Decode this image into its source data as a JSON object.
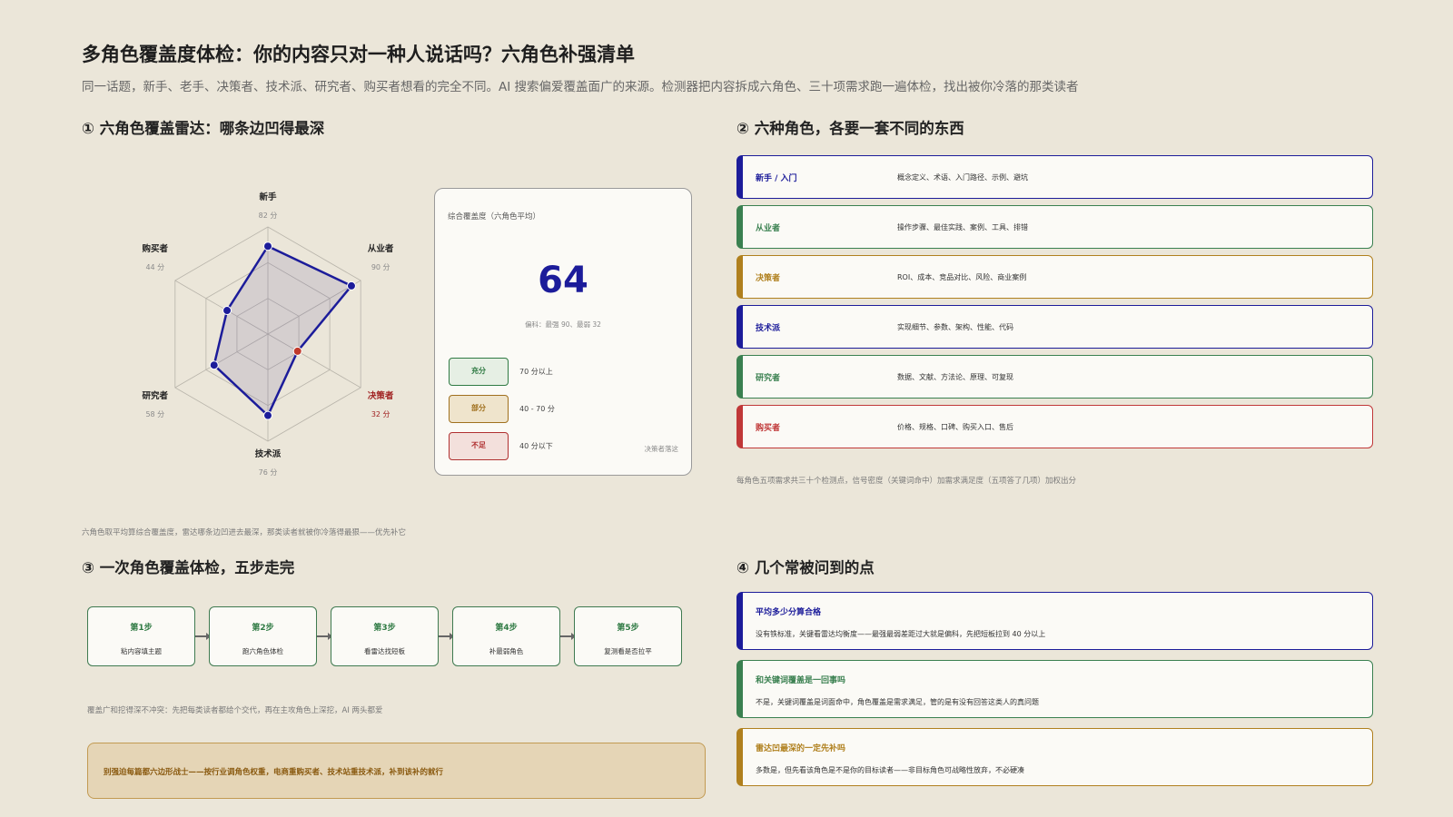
{
  "header": {
    "title": "多角色覆盖度体检：你的内容只对一种人说话吗？六角色补强清单",
    "subtitle": "同一话题，新手、老手、决策者、技术派、研究者、购买者想看的完全不同。AI 搜索偏爱覆盖面广的来源。检测器把内容拆成六角色、三十项需求跑一遍体检，找出被你冷落的那类读者"
  },
  "section1": {
    "title": "① 六角色覆盖雷达：哪条边凹得最深",
    "caption": "六角色取平均算综合覆盖度，雷达哪条边凹进去最深，那类读者就被你冷落得最狠——优先补它"
  },
  "radar": {
    "roles": [
      {
        "name": "新手",
        "score": 82,
        "score_label": "82 分",
        "status": "ok"
      },
      {
        "name": "从业者",
        "score": 90,
        "score_label": "90 分",
        "status": "ok"
      },
      {
        "name": "决策者",
        "score": 32,
        "score_label": "32 分",
        "status": "weak"
      },
      {
        "name": "技术派",
        "score": 76,
        "score_label": "76 分",
        "status": "ok"
      },
      {
        "name": "研究者",
        "score": 58,
        "score_label": "58 分",
        "status": "ok"
      },
      {
        "name": "购买者",
        "score": 44,
        "score_label": "44 分",
        "status": "ok"
      }
    ],
    "max": 100,
    "rings": 3,
    "colors": {
      "line": "#1c1c9a",
      "fill": "rgba(60,40,140,0.12)",
      "weak_point": "#c0392b",
      "weak_label": "#a02020",
      "grid": "#b8b4aa"
    }
  },
  "score_card": {
    "label": "综合覆盖度（六角色平均）",
    "value": "64",
    "bias": "偏科：最强 90、最弱 32",
    "legend": [
      {
        "badge": "充分",
        "text": "70 分以上",
        "color": "#2f7a43",
        "bg": "#e6efe4"
      },
      {
        "badge": "部分",
        "text": "40 - 70 分",
        "color": "#a0701e",
        "bg": "#efe4cc"
      },
      {
        "badge": "不足",
        "text": "40 分以下",
        "color": "#b03030",
        "bg": "#f3e0dc"
      }
    ],
    "note": "决策者落这"
  },
  "section2": {
    "title": "② 六种角色，各要一套不同的东西",
    "caption": "每角色五项需求共三十个检测点，信号密度（关键词命中）加需求满足度（五项答了几项）加权出分"
  },
  "roles": [
    {
      "name": "新手 / 入门",
      "needs": "概念定义、术语、入门路径、示例、避坑",
      "color": "#1c1c9a"
    },
    {
      "name": "从业者",
      "needs": "操作步骤、最佳实践、案例、工具、排错",
      "color": "#3a8050"
    },
    {
      "name": "决策者",
      "needs": "ROI、成本、竞品对比、风险、商业案例",
      "color": "#b0801e"
    },
    {
      "name": "技术派",
      "needs": "实现细节、参数、架构、性能、代码",
      "color": "#1c1c9a"
    },
    {
      "name": "研究者",
      "needs": "数据、文献、方法论、原理、可复现",
      "color": "#3a8050"
    },
    {
      "name": "购买者",
      "needs": "价格、规格、口碑、购买入口、售后",
      "color": "#c03838"
    }
  ],
  "section3": {
    "title": "③ 一次角色覆盖体检，五步走完",
    "caption": "覆盖广和挖得深不冲突：先把每类读者都给个交代，再在主攻角色上深挖，AI 两头都爱"
  },
  "steps": [
    {
      "title": "第1步",
      "desc": "粘内容填主题"
    },
    {
      "title": "第2步",
      "desc": "跑六角色体检"
    },
    {
      "title": "第3步",
      "desc": "看雷达找短板"
    },
    {
      "title": "第4步",
      "desc": "补最弱角色"
    },
    {
      "title": "第5步",
      "desc": "复测看是否拉平"
    }
  ],
  "tip": "别强迫每篇都六边形战士——按行业调角色权重，电商重购买者、技术站重技术派，补到该补的就行",
  "section4": {
    "title": "④ 几个常被问到的点"
  },
  "faq": [
    {
      "q": "平均多少分算合格",
      "a": "没有铁标准，关键看雷达均衡度——最强最弱差距过大就是偏科，先把短板拉到 40 分以上",
      "color": "#1c1c9a"
    },
    {
      "q": "和关键词覆盖是一回事吗",
      "a": "不是，关键词覆盖是词面命中，角色覆盖是需求满足，管的是有没有回答这类人的真问题",
      "color": "#3a8050"
    },
    {
      "q": "雷达凹最深的一定先补吗",
      "a": "多数是，但先看该角色是不是你的目标读者——非目标角色可战略性放弃，不必硬凑",
      "color": "#b0801e"
    }
  ]
}
